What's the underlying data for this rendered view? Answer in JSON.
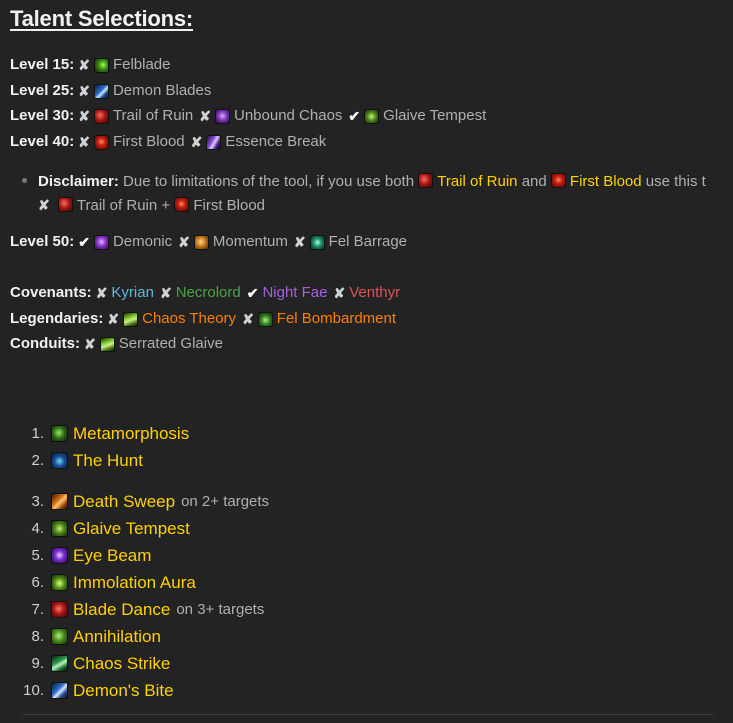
{
  "page": {
    "title": "Talent Selections:",
    "background_color": "#232323",
    "accent_gold": "#ffd100",
    "accent_orange": "#ff8000"
  },
  "marks": {
    "x": "✘",
    "check": "✔"
  },
  "talent_rows": [
    {
      "label": "Level 15:",
      "entries": [
        {
          "mark": "x",
          "icon": "felblade-icon",
          "name": "Felblade",
          "icon_class": "ico-felblade"
        }
      ]
    },
    {
      "label": "Level 25:",
      "entries": [
        {
          "mark": "x",
          "icon": "demon-blades-icon",
          "name": "Demon Blades",
          "icon_class": "ico-demonblades"
        }
      ]
    },
    {
      "label": "Level 30:",
      "entries": [
        {
          "mark": "x",
          "icon": "trail-of-ruin-icon",
          "name": "Trail of Ruin",
          "icon_class": "ico-trailofruin"
        },
        {
          "mark": "x",
          "icon": "unbound-chaos-icon",
          "name": "Unbound Chaos",
          "icon_class": "ico-unboundchaos"
        },
        {
          "mark": "check",
          "icon": "glaive-tempest-icon",
          "name": "Glaive Tempest",
          "icon_class": "ico-glaivetempest"
        }
      ]
    },
    {
      "label": "Level 40:",
      "entries": [
        {
          "mark": "x",
          "icon": "first-blood-icon",
          "name": "First Blood",
          "icon_class": "ico-firstblood"
        },
        {
          "mark": "x",
          "icon": "essence-break-icon",
          "name": "Essence Break",
          "icon_class": "ico-essencebreak"
        }
      ]
    },
    {
      "label": "Level 50:",
      "entries": [
        {
          "mark": "check",
          "icon": "demonic-icon",
          "name": "Demonic",
          "icon_class": "ico-demonic"
        },
        {
          "mark": "x",
          "icon": "momentum-icon",
          "name": "Momentum",
          "icon_class": "ico-momentum"
        },
        {
          "mark": "x",
          "icon": "fel-barrage-icon",
          "name": "Fel Barrage",
          "icon_class": "ico-felbarrage"
        }
      ]
    }
  ],
  "disclaimer": {
    "label": "Disclaimer:",
    "text_before": "Due to limitations of the tool, if you use both",
    "talent_a": "Trail of Ruin",
    "conjunction": "and",
    "talent_b": "First Blood",
    "text_after": "use this t",
    "line2_mark": "x",
    "line2_talent_a": "Trail of Ruin",
    "line2_plus": "+",
    "line2_talent_b": "First Blood"
  },
  "covenants": {
    "label": "Covenants:",
    "entries": [
      {
        "mark": "x",
        "name": "Kyrian",
        "color_class": "t-kyrian"
      },
      {
        "mark": "x",
        "name": "Necrolord",
        "color_class": "t-necrolord"
      },
      {
        "mark": "check",
        "name": "Night Fae",
        "color_class": "t-nightfae"
      },
      {
        "mark": "x",
        "name": "Venthyr",
        "color_class": "t-venthyr"
      }
    ]
  },
  "legendaries": {
    "label": "Legendaries:",
    "entries": [
      {
        "mark": "x",
        "icon": "chaos-theory-icon",
        "name": "Chaos Theory",
        "icon_class": "ico-chaostheory"
      },
      {
        "mark": "x",
        "icon": "fel-bombardment-icon",
        "name": "Fel Bombardment",
        "icon_class": "ico-felbombardment"
      }
    ]
  },
  "conduits": {
    "label": "Conduits:",
    "entries": [
      {
        "mark": "x",
        "icon": "serrated-glaive-icon",
        "name": "Serrated Glaive",
        "icon_class": "ico-serratedglaive"
      }
    ]
  },
  "priority_list": [
    {
      "num": "1.",
      "icon": "metamorphosis-icon",
      "icon_class": "ico-metamorphosis",
      "name": "Metamorphosis",
      "note": ""
    },
    {
      "num": "2.",
      "icon": "the-hunt-icon",
      "icon_class": "ico-thehunt",
      "name": "The Hunt",
      "note": ""
    },
    {
      "num": "3.",
      "icon": "death-sweep-icon",
      "icon_class": "ico-deathsweep",
      "name": "Death Sweep",
      "note": "on 2+ targets"
    },
    {
      "num": "4.",
      "icon": "glaive-tempest-icon",
      "icon_class": "ico-glaivetempest",
      "name": "Glaive Tempest",
      "note": ""
    },
    {
      "num": "5.",
      "icon": "eye-beam-icon",
      "icon_class": "ico-eyebeam",
      "name": "Eye Beam",
      "note": ""
    },
    {
      "num": "6.",
      "icon": "immolation-aura-icon",
      "icon_class": "ico-immolation",
      "name": "Immolation Aura",
      "note": ""
    },
    {
      "num": "7.",
      "icon": "blade-dance-icon",
      "icon_class": "ico-bladedance",
      "name": "Blade Dance",
      "note": "on 3+ targets"
    },
    {
      "num": "8.",
      "icon": "annihilation-icon",
      "icon_class": "ico-annihilation",
      "name": "Annihilation",
      "note": ""
    },
    {
      "num": "9.",
      "icon": "chaos-strike-icon",
      "icon_class": "ico-chaosstrike",
      "name": "Chaos Strike",
      "note": ""
    },
    {
      "num": "10.",
      "icon": "demons-bite-icon",
      "icon_class": "ico-demonsbite",
      "name": "Demon's Bite",
      "note": ""
    }
  ]
}
